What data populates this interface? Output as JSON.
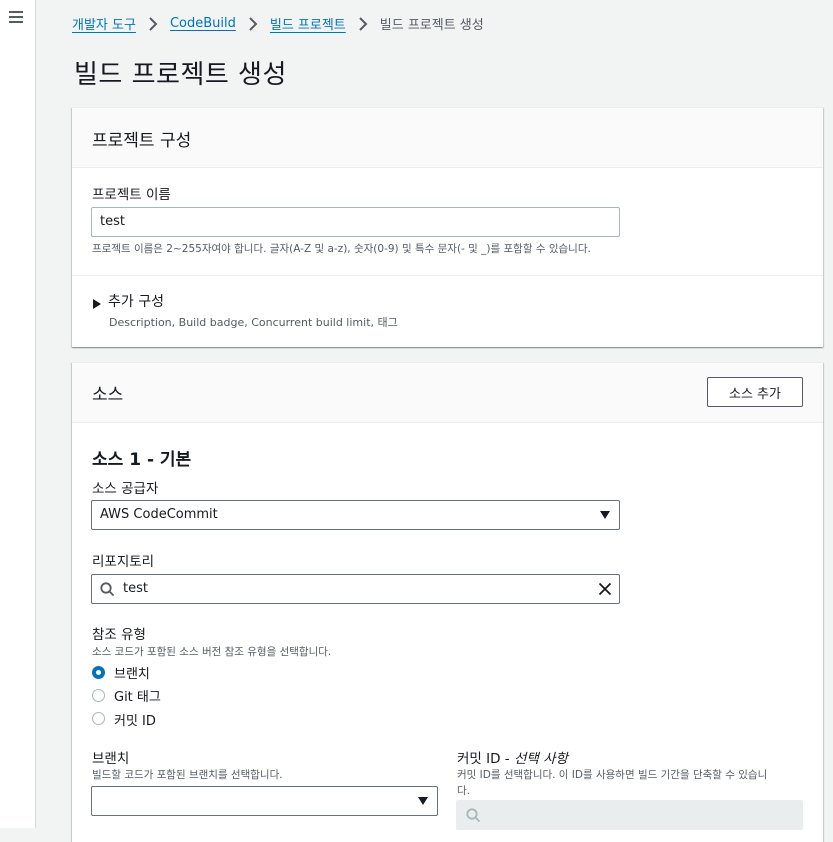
{
  "breadcrumb": {
    "items": [
      "개발자 도구",
      "CodeBuild",
      "빌드 프로젝트"
    ],
    "current": "빌드 프로젝트 생성"
  },
  "page": {
    "title": "빌드 프로젝트 생성"
  },
  "project_config": {
    "heading": "프로젝트 구성",
    "name_label": "프로젝트 이름",
    "name_value": "test",
    "name_hint": "프로젝트 이름은 2~255자여야 합니다. 글자(A-Z 및 a-z), 숫자(0-9) 및 특수 문자(- 및 _)를 포함할 수 있습니다.",
    "additional_title": "추가 구성",
    "additional_desc": "Description, Build badge, Concurrent build limit, 태그"
  },
  "source": {
    "heading": "소스",
    "add_button": "소스 추가",
    "subheading": "소스 1 - 기본",
    "provider_label": "소스 공급자",
    "provider_value": "AWS CodeCommit",
    "repo_label": "리포지토리",
    "repo_value": "test",
    "ref_type_label": "참조 유형",
    "ref_type_desc": "소스 코드가 포함된 소스 버전 참조 유형을 선택합니다.",
    "ref_options": [
      "브랜치",
      "Git 태그",
      "커밋 ID"
    ],
    "ref_selected": 0,
    "branch_label": "브랜치",
    "branch_desc": "빌드할 코드가 포함된 브랜치를 선택합니다.",
    "branch_value": "",
    "commit_label": "커밋 ID - ",
    "commit_label_optional": "선택 사항",
    "commit_desc_line1": "커밋 ID를 선택합니다. 이 ID를 사용하면 빌드 기간을 단축할 수 있습니",
    "commit_desc_line2": "다."
  },
  "colors": {
    "link": "#0073bb",
    "background": "#f2f3f3",
    "panel_header": "#fafafa"
  }
}
